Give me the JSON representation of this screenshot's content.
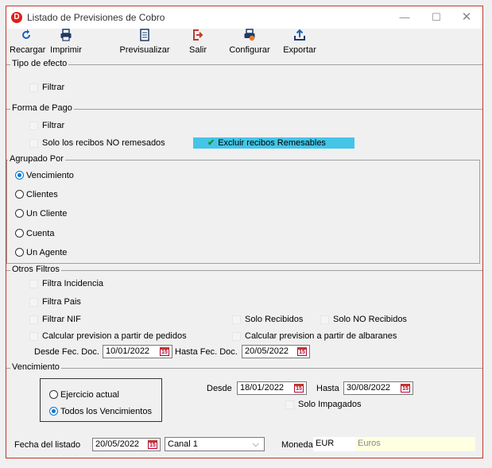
{
  "window": {
    "title": "Listado de Previsiones de Cobro",
    "logo_letter": "D"
  },
  "toolbar": {
    "recargar": "Recargar",
    "imprimir": "Imprimir",
    "previsualizar": "Previsualizar",
    "salir": "Salir",
    "configurar": "Configurar",
    "exportar": "Exportar"
  },
  "tipo_efecto": {
    "legend": "Tipo de efecto",
    "filtrar": "Filtrar"
  },
  "forma_pago": {
    "legend": "Forma de Pago",
    "filtrar": "Filtrar",
    "solo_no_remesados": "Solo los recibos NO remesados",
    "excluir_remesables": "Excluir recibos Remesables",
    "excluir_checked": true
  },
  "agrupado": {
    "legend": "Agrupado Por",
    "options": [
      "Vencimiento",
      "Clientes",
      "Un Cliente",
      "Cuenta",
      "Un Agente"
    ],
    "selected": "Vencimiento"
  },
  "otros": {
    "legend": "Otros Filtros",
    "filtra_incidencia": "Filtra Incidencia",
    "filtra_pais": "Filtra Pais",
    "filtrar_nif": "Filtrar NIF",
    "solo_recibidos": "Solo Recibidos",
    "solo_no_recibidos": "Solo NO Recibidos",
    "calc_pedidos": "Calcular prevision a partir de pedidos",
    "calc_albaranes": "Calcular prevision a partir de albaranes",
    "desde_label": "Desde Fec. Doc.",
    "desde_value": "10/01/2022",
    "hasta_label": "Hasta Fec. Doc.",
    "hasta_value": "20/05/2022",
    "cal_icon_text": "15"
  },
  "vencimiento": {
    "legend": "Vencimiento",
    "ejercicio": "Ejercicio actual",
    "todos": "Todos los Vencimientos",
    "selected": "todos",
    "desde_label": "Desde",
    "desde_value": "18/01/2022",
    "hasta_label": "Hasta",
    "hasta_value": "30/08/2022",
    "solo_impagados": "Solo Impagados"
  },
  "footer": {
    "fecha_label": "Fecha del listado",
    "fecha_value": "20/05/2022",
    "canal_value": "Canal 1",
    "moneda_label": "Moneda",
    "moneda_code": "EUR",
    "moneda_name": "Euros"
  }
}
